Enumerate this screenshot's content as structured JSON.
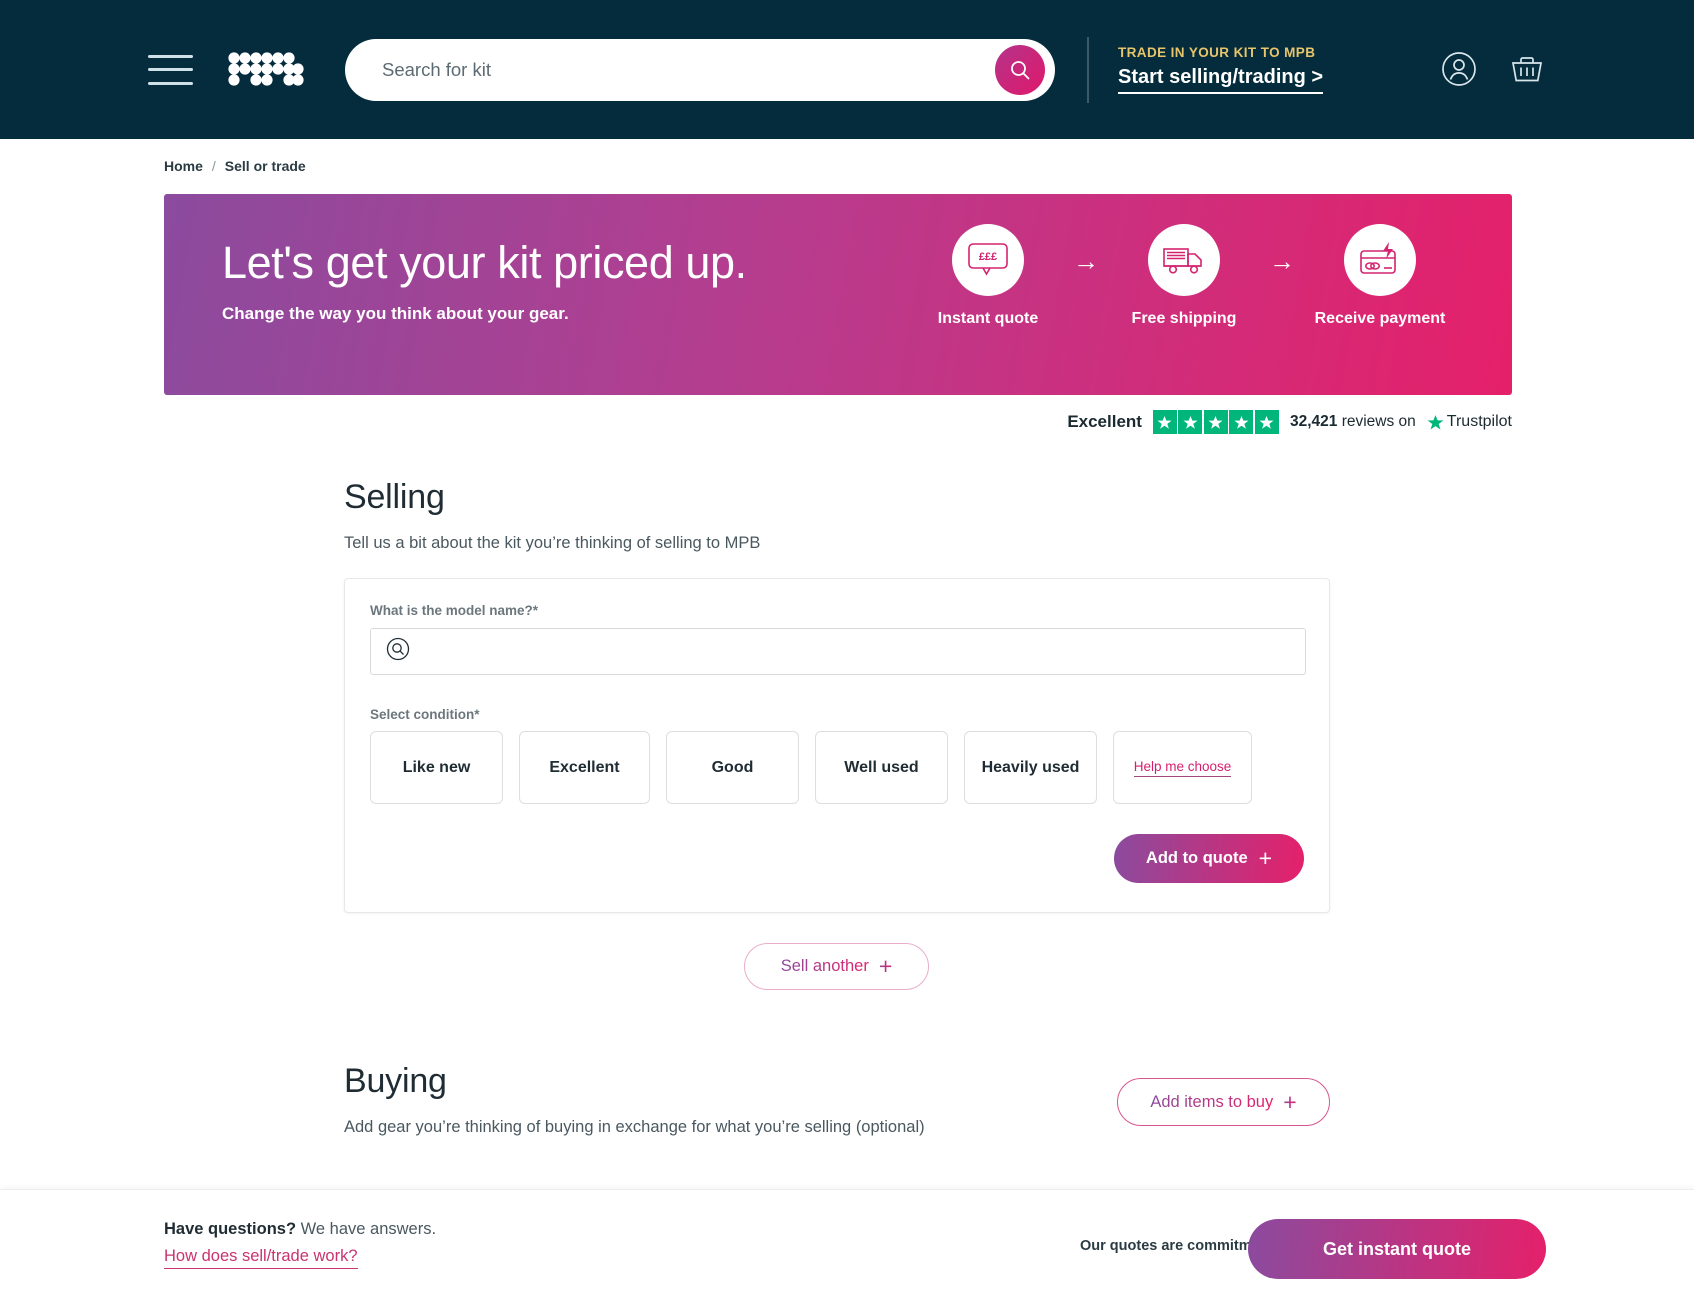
{
  "header": {
    "menu_label": "menu",
    "logo_label": "MPB",
    "search": {
      "placeholder": "Search for kit",
      "value": ""
    },
    "trade_kicker": "TRADE IN YOUR KIT TO MPB",
    "trade_link": "Start selling/trading >",
    "account_label": "Account",
    "basket_label": "Basket"
  },
  "breadcrumb": {
    "home": "Home",
    "separator": "/",
    "current": "Sell or trade"
  },
  "hero": {
    "title": "Let's get your kit priced up.",
    "subtitle": "Change the way you think about your gear.",
    "arrow": "→",
    "steps": [
      {
        "label": "Instant quote",
        "icon": "price-bubble-icon",
        "icon_text": "£££"
      },
      {
        "label": "Free shipping",
        "icon": "delivery-truck-icon"
      },
      {
        "label": "Receive payment",
        "icon": "card-payment-icon"
      }
    ],
    "gradient_from": "#8b4b9e",
    "gradient_to": "#e5206a"
  },
  "trustpilot": {
    "rating_word": "Excellent",
    "stars": 5,
    "star_color": "#00b67a",
    "reviews_count": "32,421",
    "reviews_text": "reviews on",
    "brand": "Trustpilot"
  },
  "selling": {
    "heading": "Selling",
    "subheading": "Tell us a bit about the kit you’re thinking of selling to MPB",
    "model_label": "What is the model name?*",
    "model_placeholder": "",
    "model_value": "",
    "condition_label": "Select condition*",
    "conditions": [
      "Like new",
      "Excellent",
      "Good",
      "Well used",
      "Heavily used"
    ],
    "help_me_choose": "Help me choose",
    "add_to_quote": "Add to quote",
    "sell_another": "Sell another",
    "plus": "+"
  },
  "buying": {
    "heading": "Buying",
    "subheading": "Add gear you’re thinking of buying in exchange for what you’re selling (optional)",
    "add_items": "Add items to buy",
    "plus": "+"
  },
  "footer": {
    "questions_bold": "Have questions?",
    "questions_rest": " We have answers.",
    "how_link": "How does sell/trade work?",
    "note": "Our quotes are commitment free",
    "cta": "Get instant quote"
  },
  "colors": {
    "header_bg": "#042c3c",
    "accent_pink": "#e5206a",
    "accent_purple": "#8b4b9e",
    "kicker_gold": "#e8c46a"
  }
}
